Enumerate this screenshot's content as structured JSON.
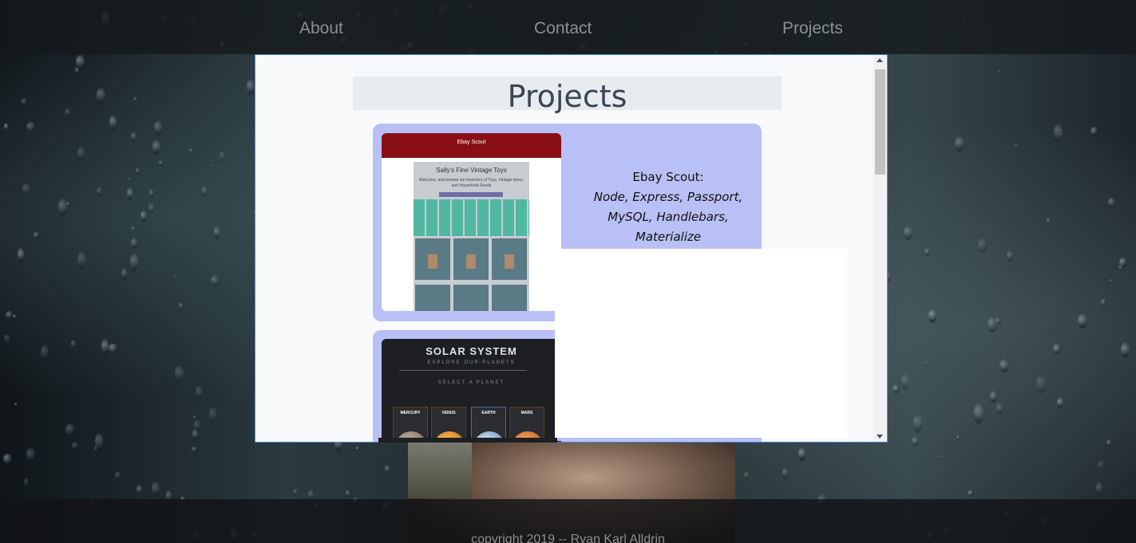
{
  "nav": {
    "links": [
      "About",
      "Contact",
      "Projects"
    ]
  },
  "modal": {
    "title": "Projects",
    "cards": [
      {
        "name": "Ebay Scout:",
        "tech_lines": [
          "Node, Express, Passport,",
          "MySQL, Handlebars,",
          "Materialize"
        ],
        "thumb": {
          "header": "Ebay Scout",
          "panel_title": "Sally's Fine Vintage Toys",
          "panel_sub": "Welcome, and browse our inventory of Toys, Vintage items, and Household Goods"
        }
      },
      {
        "thumb": {
          "title": "SOLAR SYSTEM",
          "sub": "EXPLORE OUR PLANETS",
          "select": "SELECT A PLANET",
          "planets": [
            "MERCURY",
            "VENUS",
            "EARTH",
            "MARS"
          ]
        }
      }
    ]
  },
  "footer": {
    "text": "copyright 2019 -- Ryan Karl Alldrin"
  },
  "colors": {
    "card_bg": "#b8c0f5",
    "modal_border": "#4d8bd8",
    "ebay_red": "#8a0f14"
  }
}
